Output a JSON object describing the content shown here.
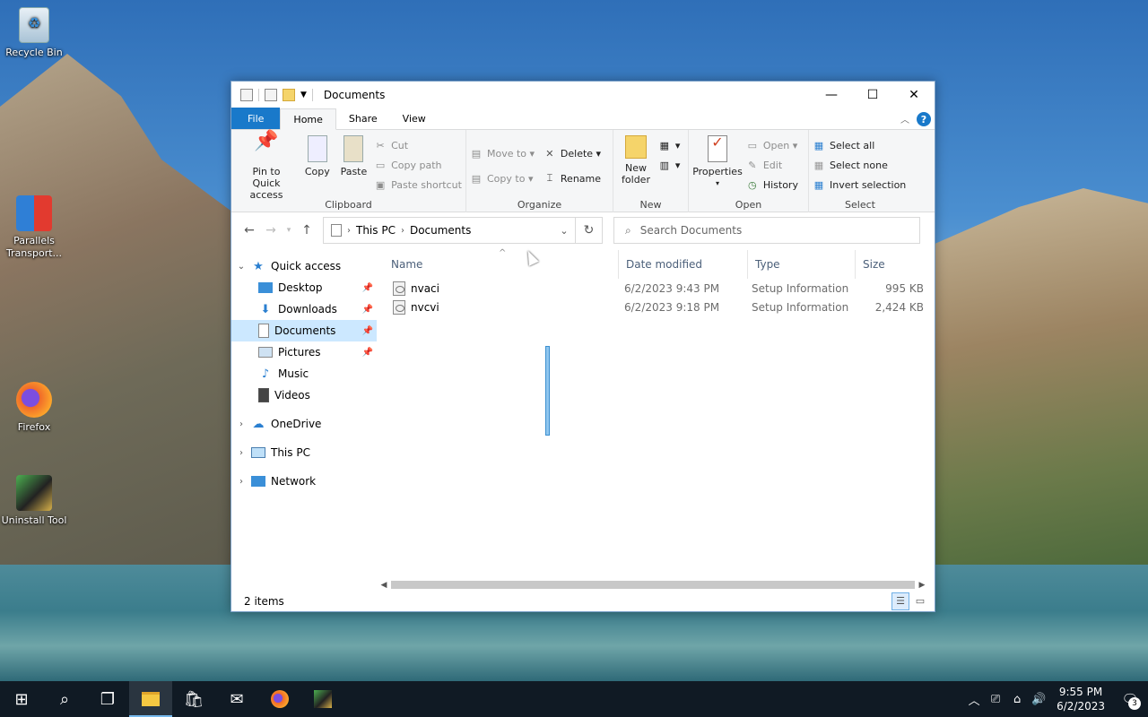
{
  "desktop": {
    "icons": [
      {
        "label": "Recycle Bin",
        "icon": "recycle-bin-icon"
      },
      {
        "label": "Parallels Transport...",
        "icon": "parallels-transporter-icon"
      },
      {
        "label": "Firefox",
        "icon": "firefox-icon"
      },
      {
        "label": "Uninstall Tool",
        "icon": "uninstall-tool-icon"
      }
    ]
  },
  "window": {
    "title": "Documents",
    "controls": {
      "minimize": "—",
      "maximize": "☐",
      "close": "✕"
    }
  },
  "ribbon": {
    "tabs": [
      "File",
      "Home",
      "Share",
      "View"
    ],
    "active_tab": "Home",
    "help": "?",
    "clipboard": {
      "pin": "Pin to Quick access",
      "copy": "Copy",
      "paste": "Paste",
      "cut": "Cut",
      "copy_path": "Copy path",
      "paste_shortcut": "Paste shortcut",
      "label": "Clipboard"
    },
    "organize": {
      "move_to": "Move to",
      "copy_to": "Copy to",
      "delete": "Delete",
      "rename": "Rename",
      "label": "Organize"
    },
    "new": {
      "new_folder": "New folder",
      "label": "New"
    },
    "open": {
      "properties": "Properties",
      "open": "Open",
      "edit": "Edit",
      "history": "History",
      "label": "Open"
    },
    "select": {
      "select_all": "Select all",
      "select_none": "Select none",
      "invert": "Invert selection",
      "label": "Select"
    }
  },
  "address": {
    "crumbs": [
      "This PC",
      "Documents"
    ],
    "search_placeholder": "Search Documents"
  },
  "nav": {
    "quick_access": "Quick access",
    "quick_items": [
      {
        "label": "Desktop",
        "icon": "desktop-folder-icon",
        "pinned": true
      },
      {
        "label": "Downloads",
        "icon": "downloads-folder-icon",
        "pinned": true
      },
      {
        "label": "Documents",
        "icon": "documents-folder-icon",
        "pinned": true,
        "selected": true
      },
      {
        "label": "Pictures",
        "icon": "pictures-folder-icon",
        "pinned": true
      },
      {
        "label": "Music",
        "icon": "music-folder-icon",
        "pinned": false
      },
      {
        "label": "Videos",
        "icon": "videos-folder-icon",
        "pinned": false
      }
    ],
    "onedrive": "OneDrive",
    "this_pc": "This PC",
    "network": "Network"
  },
  "files": {
    "columns": [
      "Name",
      "Date modified",
      "Type",
      "Size"
    ],
    "rows": [
      {
        "name": "nvaci",
        "date": "6/2/2023 9:43 PM",
        "type": "Setup Information",
        "size": "995 KB"
      },
      {
        "name": "nvcvi",
        "date": "6/2/2023 9:18 PM",
        "type": "Setup Information",
        "size": "2,424 KB"
      }
    ]
  },
  "status": {
    "items": "2 items"
  },
  "taskbar": {
    "time": "9:55 PM",
    "date": "6/2/2023",
    "notifications": "3"
  },
  "colors": {
    "accent": "#1979ca",
    "selection": "#cce8ff",
    "taskbar": "#101a24"
  }
}
